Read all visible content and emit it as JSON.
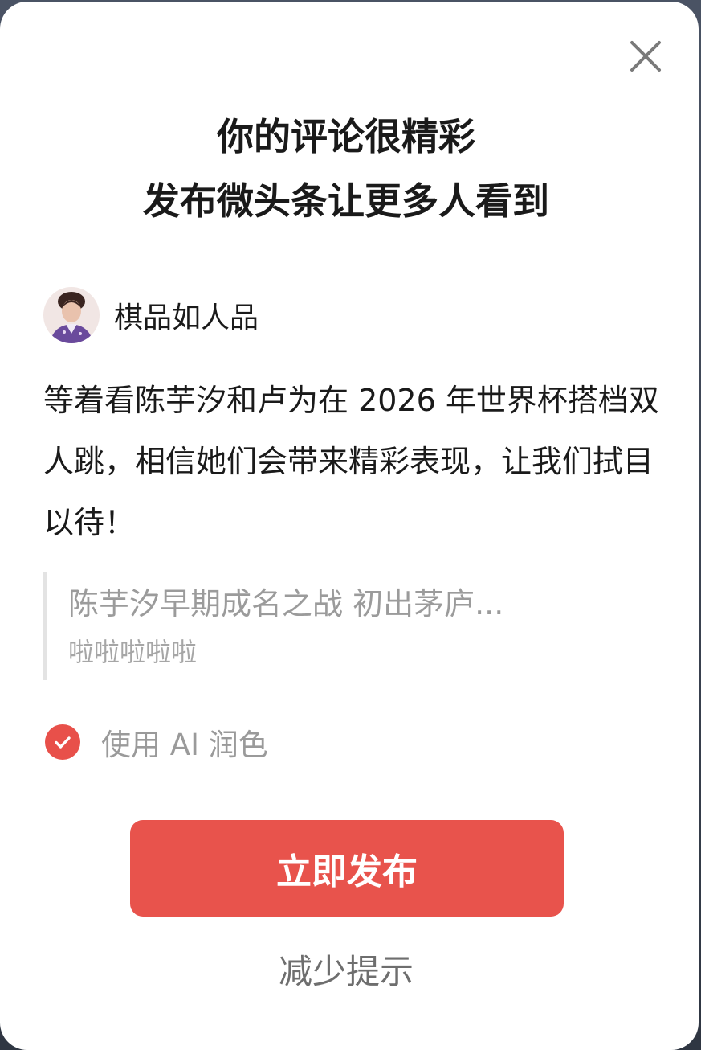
{
  "dialog": {
    "title_line1": "你的评论很精彩",
    "title_line2": "发布微头条让更多人看到",
    "close_icon": "close-icon"
  },
  "user": {
    "name": "棋品如人品",
    "avatar_icon": "avatar"
  },
  "comment": {
    "text": "等着看陈芋汐和卢为在 2026 年世界杯搭档双人跳，相信她们会带来精彩表现，让我们拭目以待！"
  },
  "quote": {
    "title": "陈芋汐早期成名之战 初出茅庐...",
    "subtitle": "啦啦啦啦啦"
  },
  "ai_option": {
    "label": "使用 AI 润色",
    "checked": true,
    "check_icon": "check-icon"
  },
  "actions": {
    "publish_label": "立即发布",
    "reduce_label": "减少提示"
  },
  "colors": {
    "accent": "#e8534c",
    "title_text": "#1a1a1a",
    "muted_text": "#9a9a9a"
  }
}
